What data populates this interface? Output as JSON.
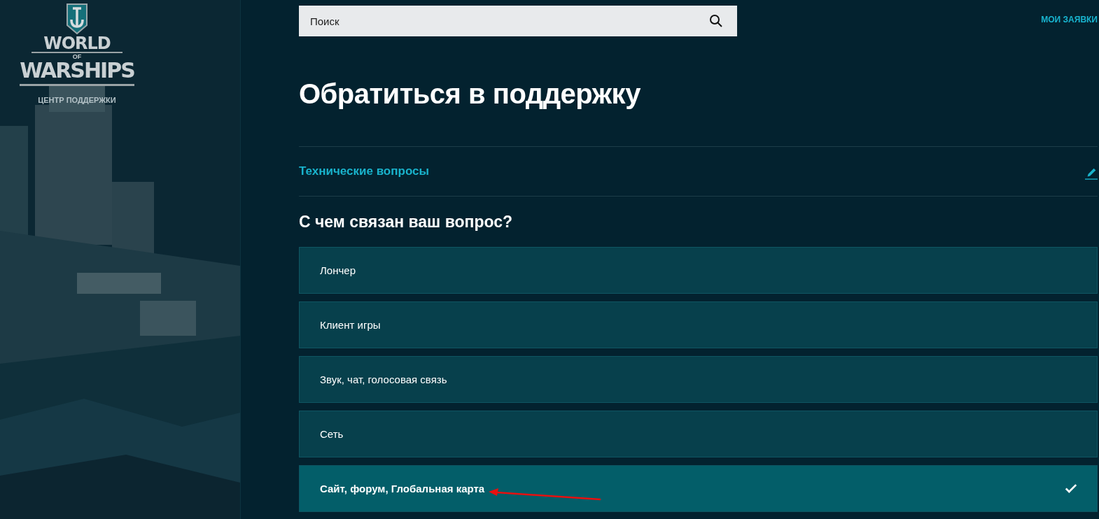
{
  "sidebar": {
    "logo": {
      "line_1": "WORLD",
      "line_2": "OF",
      "line_3": "WARSHIPS"
    },
    "subtitle": "ЦЕНТР ПОДДЕРЖКИ"
  },
  "search": {
    "placeholder": "Поиск"
  },
  "header_link": "МОИ ЗАЯВКИ",
  "title": "Обратиться в поддержку",
  "category": {
    "label": "Технические вопросы"
  },
  "question": "С чем связан ваш вопрос?",
  "options": [
    {
      "label": "Лончер",
      "selected": false
    },
    {
      "label": "Клиент игры",
      "selected": false
    },
    {
      "label": "Звук, чат, голосовая связь",
      "selected": false
    },
    {
      "label": "Сеть",
      "selected": false
    },
    {
      "label": "Сайт, форум, Глобальная карта",
      "selected": true
    }
  ]
}
